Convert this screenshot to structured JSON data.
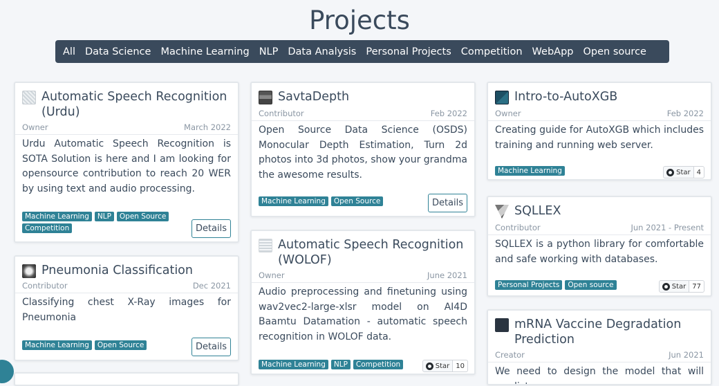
{
  "page": {
    "title": "Projects"
  },
  "filters": [
    "All",
    "Data Science",
    "Machine Learning",
    "NLP",
    "Data Analysis",
    "Personal Projects",
    "Competition",
    "WebApp",
    "Open source"
  ],
  "cards": {
    "asr_urdu": {
      "title": "Automatic Speech Recognition (Urdu)",
      "role": "Owner",
      "date": "March 2022",
      "desc": "Urdu Automatic Speech Recognition is SOTA Solution is here and I am looking for opensource contribution to reach 20 WER by using text and audio processing.",
      "tags": [
        "Machine Learning",
        "NLP",
        "Open Source",
        "Competition"
      ],
      "details": "Details"
    },
    "pneumonia": {
      "title": "Pneumonia Classification",
      "role": "Contributor",
      "date": "Dec 2021",
      "desc": "Classifying chest X-Ray images for Pneumonia",
      "tags": [
        "Machine Learning",
        "Open Source"
      ],
      "details": "Details"
    },
    "savta": {
      "title": "SavtaDepth",
      "role": "Contributor",
      "date": "Feb 2022",
      "desc": "Open Source Data Science (OSDS) Monocular Depth Estimation, Turn 2d photos into 3d photos, show your grandma the awesome results.",
      "tags": [
        "Machine Learning",
        "Open Source"
      ],
      "details": "Details"
    },
    "asr_wolof": {
      "title": "Automatic Speech Recognition (WOLOF)",
      "role": "Owner",
      "date": "June 2021",
      "desc": "Audio preprocessing and finetuning using wav2vec2-large-xlsr model on AI4D Baamtu Datamation - automatic speech recognition in WOLOF data.",
      "tags": [
        "Machine Learning",
        "NLP",
        "Competition"
      ],
      "star": "Star",
      "stars": "10"
    },
    "autoxgb": {
      "title": "Intro-to-AutoXGB",
      "role": "Owner",
      "date": "Feb 2022",
      "desc": "Creating guide for AutoXGB which includes training and running web server.",
      "tags": [
        "Machine Learning"
      ],
      "star": "Star",
      "stars": "4"
    },
    "sqllex": {
      "title": "SQLLEX",
      "role": "Contributor",
      "date": "Jun 2021 - Present",
      "desc": "SQLLEX is a python library for comfortable and safe working with databases.",
      "tags": [
        "Personal Projects",
        "Open source"
      ],
      "star": "Star",
      "stars": "77"
    },
    "mrna": {
      "title": "mRNA Vaccine Degradation Prediction",
      "role": "Creator",
      "date": "Jun 2021",
      "desc": "We need to design the model that will predict"
    }
  },
  "colors": {
    "accent": "#2f8296",
    "dark": "#3a4a5c"
  }
}
